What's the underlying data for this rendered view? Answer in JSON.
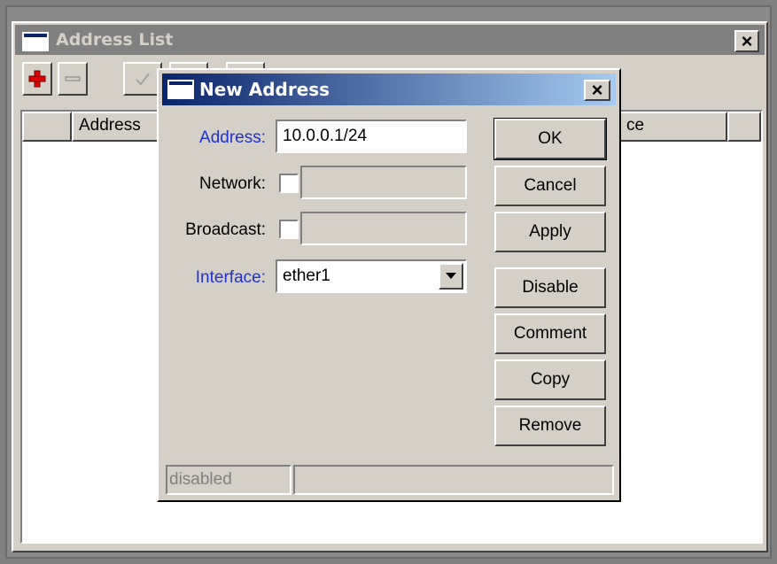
{
  "address_list_window": {
    "title": "Address List",
    "columns": [
      "Address",
      "Interface"
    ],
    "visible_column_fragment": "ce",
    "toolbar_icons": [
      "add-icon",
      "remove-icon",
      "enable-icon",
      "disable-icon",
      "comment-icon"
    ]
  },
  "dialog": {
    "title": "New Address",
    "address_label": "Address:",
    "address_value": "10.0.0.1/24",
    "network_label": "Network:",
    "network_value": "",
    "broadcast_label": "Broadcast:",
    "broadcast_value": "",
    "interface_label": "Interface:",
    "interface_value": "ether1",
    "buttons": {
      "ok": "OK",
      "cancel": "Cancel",
      "apply": "Apply",
      "disable": "Disable",
      "comment": "Comment",
      "copy": "Copy",
      "remove": "Remove"
    },
    "status": "disabled",
    "status_secondary": ""
  },
  "close_glyph": "×",
  "colors": {
    "face": "#d4d0c8",
    "inactive_titlebar": "#808080",
    "active_titlebar_start": "#0a246a",
    "active_titlebar_end": "#a6caf0",
    "label_blue": "#1e32d6"
  }
}
